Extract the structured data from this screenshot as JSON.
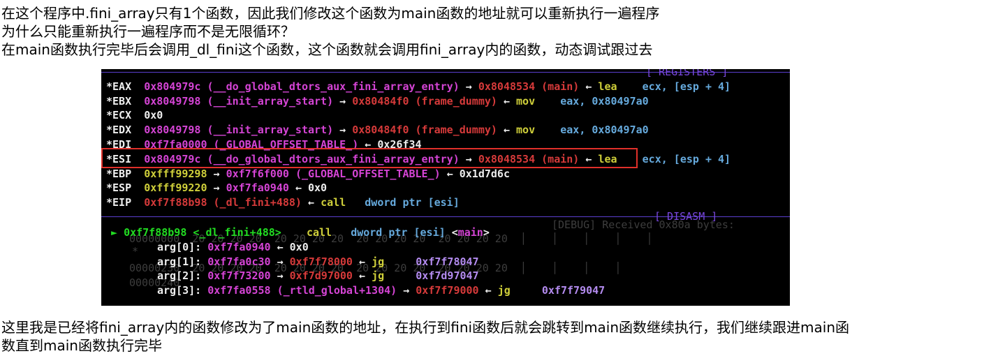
{
  "paragraphs": {
    "top": [
      "在这个程序中.fini_array只有1个函数，因此我们修改这个函数为main函数的地址就可以重新执行一遍程序",
      "为什么只能重新执行一遍程序而不是无限循环？",
      "在main函数执行完毕后会调用_dl_fini这个函数，这个函数就会调用fini_array内的函数，动态调试跟过去"
    ],
    "bottom": [
      "这里我是已经将fini_array内的函数修改为了main函数的地址，在执行到fini函数后就会跳转到main函数继续执行，我们继续跟进main函",
      "数直到main函数执行完毕"
    ]
  },
  "terminal": {
    "registers_header": "[ REGISTERS ]",
    "disasm_header": "[ DISASM ]",
    "registers": [
      {
        "name": "*EAX",
        "addr": "0x804979c",
        "sym": "(__do_global_dtors_aux_fini_array_entry)",
        "arrow1": "→",
        "t1": "0x8048534",
        "t1sym": "(main)",
        "arrow2": "←",
        "op": "lea",
        "args": "    ecx, [esp + 4]"
      },
      {
        "name": "*EBX",
        "addr": "0x8049798",
        "sym": "(__init_array_start)",
        "arrow1": "→",
        "t1": "0x80484f0",
        "t1sym": "(frame_dummy)",
        "arrow2": "←",
        "op": "mov",
        "args": "    eax, 0x80497a0"
      },
      {
        "name": "*ECX",
        "addr": "0x0"
      },
      {
        "name": "*EDX",
        "addr": "0x8049798",
        "sym": "(__init_array_start)",
        "arrow1": "→",
        "t1": "0x80484f0",
        "t1sym": "(frame_dummy)",
        "arrow2": "←",
        "op": "mov",
        "args": "    eax, 0x80497a0"
      },
      {
        "name": "*EDI",
        "addr": "0xf7fa0000",
        "sym": "(_GLOBAL_OFFSET_TABLE_)",
        "arrow2": "←",
        "val": "0x26f34"
      },
      {
        "name": "*ESI",
        "addr": "0x804979c",
        "sym": "(__do_global_dtors_aux_fini_array_entry)",
        "arrow1": "→",
        "t1": "0x8048534",
        "t1sym": "(main)",
        "arrow2": "←",
        "op": "lea",
        "args": "    ecx, [esp + 4]"
      },
      {
        "name": "*EBP",
        "addr": "0xfff99298",
        "arrow1": "→",
        "t1": "0xf7f6f000",
        "t1sym": "(_GLOBAL_OFFSET_TABLE_)",
        "arrow2": "←",
        "val": "0x1d7d6c"
      },
      {
        "name": "*ESP",
        "addr": "0xfff99220",
        "arrow1": "→",
        "t1": "0xf7fa0940",
        "arrow2": "←",
        "val": "0x0"
      },
      {
        "name": "*EIP",
        "addr": "0xf7f88b98",
        "sym": "(_dl_fini+488)",
        "arrow2": "←",
        "op": "call",
        "args": "   dword ptr [esi]"
      }
    ],
    "disasm": {
      "marker": "►",
      "addr": "0xf7f88b98",
      "sym": "<_dl_fini+488>",
      "op": "call",
      "operand": "dword ptr [esi]",
      "target_open": "<",
      "target": "main",
      "target_close": ">"
    },
    "args": [
      {
        "label": "arg[0]:",
        "v1": "0xf7fa0940",
        "arrow": "←",
        "v2": "0x0"
      },
      {
        "label": "arg[1]:",
        "v1": "0xf7fa0c30",
        "arrow": "→",
        "v2": "0xf7f78000",
        "arrow2": "←",
        "op": "jg",
        "v3": "0xf7f78047"
      },
      {
        "label": "arg[2]:",
        "v1": "0xf7f73200",
        "arrow": "→",
        "v2": "0xf7d97000",
        "arrow2": "←",
        "op": "jg",
        "v3": "0xf7d97047"
      },
      {
        "label": "arg[3]:",
        "v1": "0xf7fa0558",
        "sym": "(_rtld_global+1304)",
        "arrow": "→",
        "v2": "0xf7f79000",
        "arrow2": "←",
        "op": "jg",
        "v3": "0xf7f79047"
      }
    ],
    "ghost_debug": "[DEBUG] Received 0x80a bytes:",
    "ghost_hex": "00000000  20 20 20 20  20 20 20 20  20 20 20 20  20 20 20 20  │    │    │    │    │",
    "ghost_star": "*",
    "ghost_line2": "00000230  20 20 20 20  20 20 20 20  20 20 20 20  20 20 20 20  │    │    │    │",
    "ghost_line3": "00000240"
  },
  "colors": {
    "highlight_box": "#e0302a",
    "separator": "#5b3fd0"
  }
}
